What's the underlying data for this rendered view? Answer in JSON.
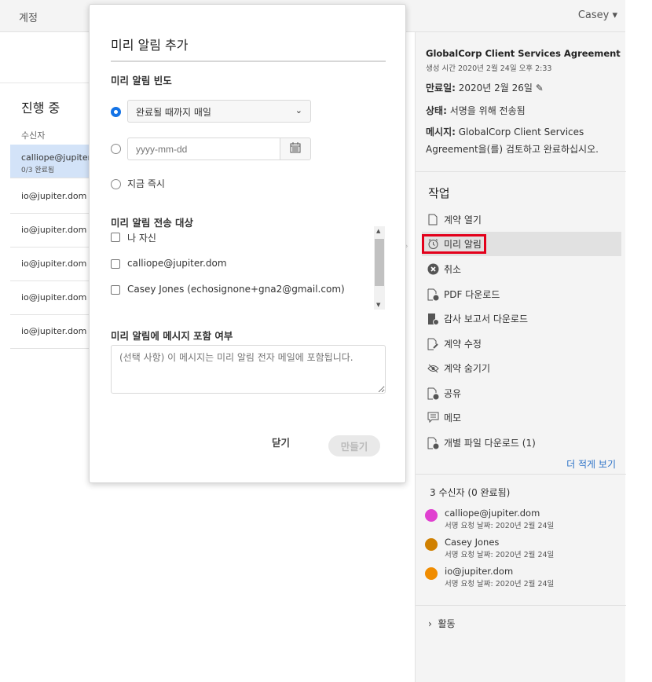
{
  "topbar": {
    "account": "계정",
    "user": "Casey",
    "user_caret": "▾"
  },
  "left": {
    "section_title": "진행 중",
    "column_header": "수신자",
    "rows": [
      {
        "name": "calliope@jupiter.dom",
        "sub": "0/3 완료됨",
        "selected": true
      },
      {
        "name": "io@jupiter.dom"
      },
      {
        "name": "io@jupiter.dom"
      },
      {
        "name": "io@jupiter.dom"
      },
      {
        "name": "io@jupiter.dom"
      },
      {
        "name": "io@jupiter.dom"
      }
    ]
  },
  "modal": {
    "title": "미리 알림 추가",
    "frequency_heading": "미리 알림 빈도",
    "frequency_select": "완료될 때까지 매일",
    "date_placeholder": "yyyy-mm-dd",
    "now_option": "지금 즉시",
    "recipients_heading": "미리 알림 전송 대상",
    "recipients": [
      "나 자신",
      "calliope@jupiter.dom",
      "Casey Jones (echosignone+gna2@gmail.com)"
    ],
    "message_heading": "미리 알림에 메시지 포함 여부",
    "message_placeholder": "(선택 사항) 이 메시지는 미리 알림 전자 메일에 포함됩니다.",
    "close_label": "닫기",
    "create_label": "만들기"
  },
  "panel": {
    "agreement_title": "GlobalCorp Client Services Agreement",
    "created": "생성 시간 2020년 2월 24일 오후 2:33",
    "expiry_label": "만료일:",
    "expiry_value": "2020년 2월 26일",
    "status_label": "상태:",
    "status_value": "서명을 위해 전송됨",
    "message_label": "메시지:",
    "message_value": "GlobalCorp Client Services Agreement을(를) 검토하고 완료하십시오.",
    "tasks_heading": "작업",
    "tasks": [
      {
        "label": "계약 열기",
        "icon": "document-icon"
      },
      {
        "label": "미리 알림",
        "icon": "alarm-clock-icon"
      },
      {
        "label": "취소",
        "icon": "cancel-circle-icon"
      },
      {
        "label": "PDF 다운로드",
        "icon": "pdf-download-icon"
      },
      {
        "label": "감사 보고서 다운로드",
        "icon": "audit-report-icon"
      },
      {
        "label": "계약 수정",
        "icon": "edit-document-icon"
      },
      {
        "label": "계약 숨기기",
        "icon": "hide-eye-icon"
      },
      {
        "label": "공유",
        "icon": "share-document-icon"
      },
      {
        "label": "메모",
        "icon": "note-comment-icon"
      },
      {
        "label": "개별 파일 다운로드 (1)",
        "icon": "file-download-icon"
      }
    ],
    "show_less": "더 적게 보기",
    "recipients_heading": "3 수신자 (0 완료됨)",
    "recipients": [
      {
        "name": "calliope@jupiter.dom",
        "date": "서명 요청 날짜: 2020년 2월 24일",
        "color": "#e040d0"
      },
      {
        "name": "Casey Jones",
        "date": "서명 요청 날짜: 2020년 2월 24일",
        "color": "#d08000"
      },
      {
        "name": "io@jupiter.dom",
        "date": "서명 요청 날짜: 2020년 2월 24일",
        "color": "#f08c00"
      }
    ],
    "activity": "활동"
  },
  "colors": {
    "accent": "#1473e6",
    "highlight_border": "#e3001b",
    "link": "#2e73c8",
    "selected_row": "#d3e3f8"
  }
}
